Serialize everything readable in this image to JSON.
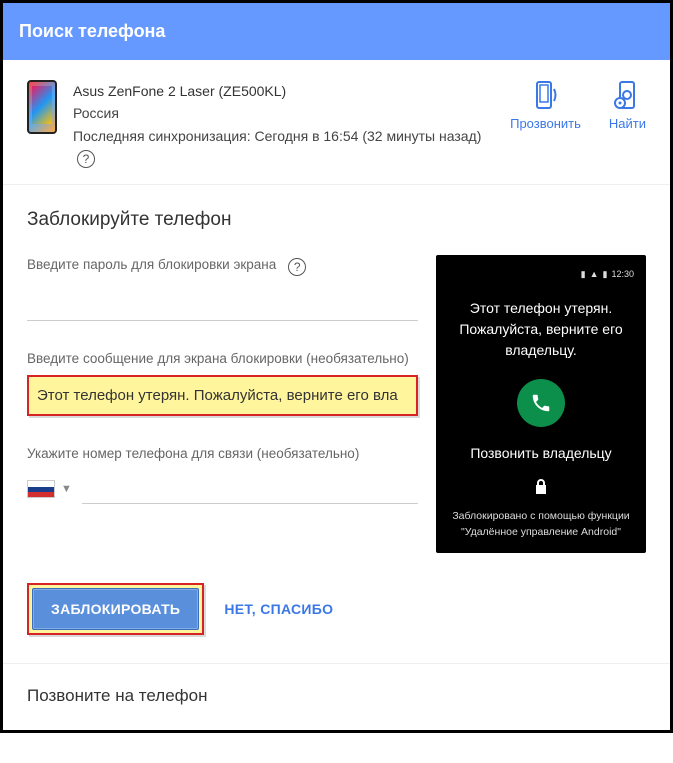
{
  "header": {
    "title": "Поиск телефона"
  },
  "device": {
    "name": "Asus ZenFone 2 Laser (ZE500KL)",
    "location": "Россия",
    "sync_text": "Последняя синхронизация: Сегодня в 16:54 (32 минуты назад)"
  },
  "actions": {
    "ring": "Прозвонить",
    "locate": "Найти"
  },
  "lock": {
    "title": "Заблокируйте телефон",
    "password_label": "Введите пароль для блокировки экрана",
    "message_label": "Введите сообщение для экрана блокировки (необязательно)",
    "message_value": "Этот телефон утерян. Пожалуйста, верните его вла",
    "phone_label": "Укажите номер телефона для связи (необязательно)"
  },
  "preview": {
    "time": "12:30",
    "lost_message": "Этот телефон утерян. Пожалуйста, верните его владельцу.",
    "call_owner": "Позвонить владельцу",
    "locked_by_line1": "Заблокировано с помощью функции",
    "locked_by_line2": "\"Удалённое управление Android\""
  },
  "buttons": {
    "lock": "ЗАБЛОКИРОВАТЬ",
    "no_thanks": "НЕТ, СПАСИБО"
  },
  "call_section": {
    "title": "Позвоните на телефон"
  }
}
